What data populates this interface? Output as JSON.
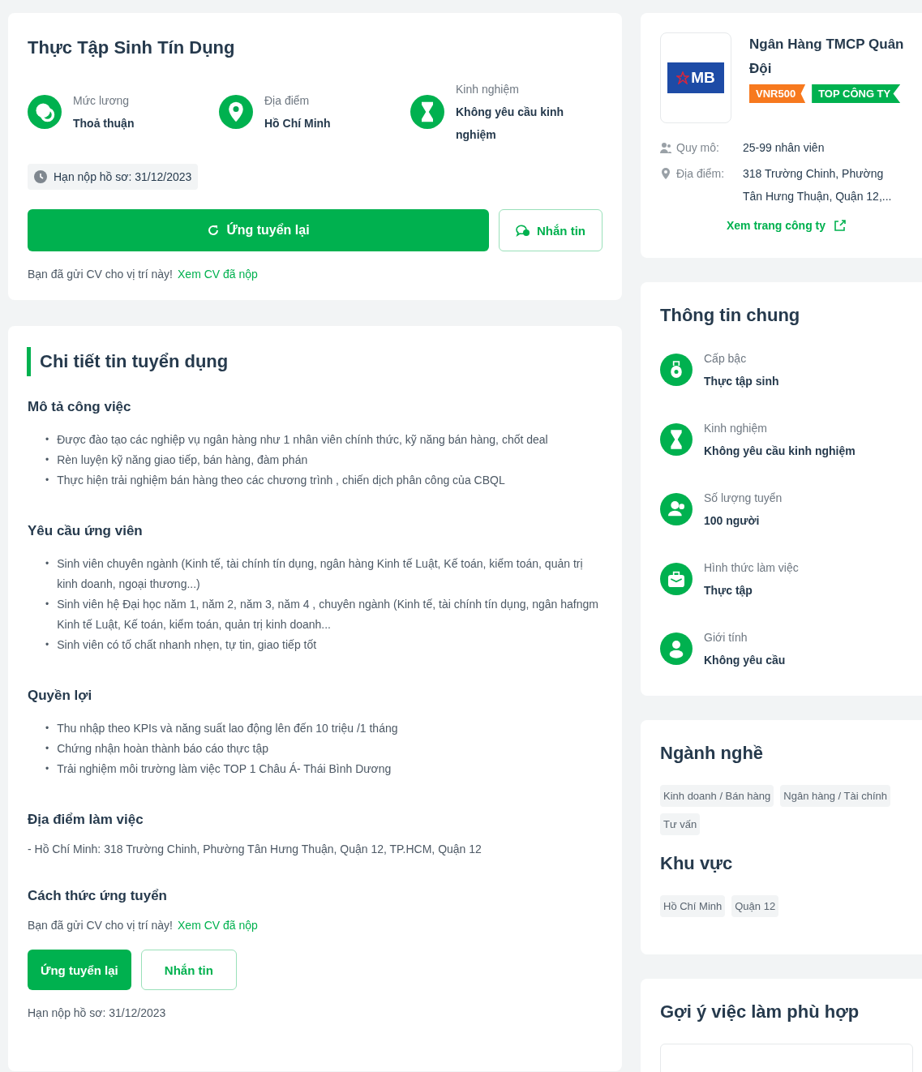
{
  "job": {
    "title": "Thực Tập Sinh Tín Dụng",
    "highlights": [
      {
        "kind": "salary",
        "label": "Mức lương",
        "value": "Thoả thuận"
      },
      {
        "kind": "location",
        "label": "Địa điểm",
        "value": "Hồ Chí Minh"
      },
      {
        "kind": "experience",
        "label": "Kinh nghiệm",
        "value": "Không yêu cầu kinh nghiệm"
      }
    ],
    "deadline": "Hạn nộp hồ sơ: 31/12/2023",
    "apply_button": "Ứng tuyển lại",
    "message_button": "Nhắn tin",
    "applied_note": "Bạn đã gửi CV cho vị trí này!",
    "applied_link": "Xem CV đã nộp"
  },
  "details": {
    "heading": "Chi tiết tin tuyển dụng",
    "sections": [
      {
        "kind": "list",
        "title": "Mô tả công việc",
        "bullet": "•",
        "items": [
          "Được đào tạo các nghiệp vụ ngân hàng như 1 nhân viên chính thức, kỹ năng bán hàng, chốt deal",
          "Rèn luyện kỹ năng giao tiếp, bán hàng, đàm phán",
          "Thực hiện trải nghiệm bán hàng theo các chương trình , chiến dịch phân  công của CBQL"
        ]
      },
      {
        "kind": "list",
        "title": "Yêu cầu ứng viên",
        "bullet": "•",
        "items": [
          "Sinh viên chuyên ngành (Kinh tế, tài chính tín dụng, ngân hàng Kinh tế Luật, Kế toán, kiểm toán, quản trị kinh doanh, ngoại thương...)",
          "Sinh viên hệ Đại học  năm 1, năm 2, năm 3, năm 4 , chuyên ngành (Kinh tế, tài chính tín dụng, ngân hafngm Kinh tế Luật, Kế toán, kiểm toán, quản trị kinh doanh...",
          "Sinh viên có tố chất nhanh nhẹn, tự tin, giao tiếp tốt"
        ]
      },
      {
        "kind": "list",
        "title": "Quyền lợi",
        "bullet": "•",
        "items": [
          "Thu nhập theo KPIs và năng suất lao động lên đến 10 triệu /1 tháng",
          "Chứng nhận hoàn thành báo cáo thực tập",
          "Trải nghiệm môi trường làm việc TOP 1 Châu Á- Thái Bình Dương"
        ]
      },
      {
        "kind": "text",
        "title": "Địa điểm làm việc",
        "text": "- Hồ Chí Minh: 318 Trường Chinh, Phường Tân Hưng Thuận, Quận 12, TP.HCM, Quận 12"
      },
      {
        "kind": "apply",
        "title": "Cách thức ứng tuyển",
        "note": "Bạn đã gửi CV cho vị trí này!",
        "link": "Xem CV đã nộp",
        "apply_button": "Ứng tuyển lại",
        "message_button": "Nhắn tin",
        "deadline": "Hạn nộp hồ sơ: 31/12/2023"
      }
    ]
  },
  "company": {
    "logo_text": "MB",
    "name": "Ngân Hàng TMCP Quân Đội",
    "badges": [
      {
        "text": "VNR500",
        "color": "#f7791e"
      },
      {
        "text": "TOP CÔNG TY",
        "color": "#00b14f"
      }
    ],
    "facts": [
      {
        "kind": "scale",
        "label": "Quy mô:",
        "value": "25-99 nhân viên"
      },
      {
        "kind": "address",
        "label": "Địa điểm:",
        "value": "318 Trường Chinh, Phường Tân Hưng Thuận, Quận 12,..."
      }
    ],
    "link": "Xem trang công ty"
  },
  "general": {
    "title": "Thông tin chung",
    "items": [
      {
        "kind": "rank",
        "label": "Cấp bậc",
        "value": "Thực tập sinh"
      },
      {
        "kind": "experience",
        "label": "Kinh nghiệm",
        "value": "Không yêu cầu kinh nghiệm"
      },
      {
        "kind": "people",
        "label": "Số lượng tuyển",
        "value": "100 người"
      },
      {
        "kind": "work",
        "label": "Hình thức làm việc",
        "value": "Thực tập"
      },
      {
        "kind": "gender",
        "label": "Giới tính",
        "value": "Không yêu cầu"
      }
    ]
  },
  "categories": {
    "title": "Ngành nghề",
    "tags": [
      "Kinh doanh / Bán hàng",
      "Ngân hàng / Tài chính",
      "Tư vấn"
    ]
  },
  "region": {
    "title": "Khu vực",
    "tags": [
      "Hồ Chí Minh",
      "Quận 12"
    ]
  },
  "suggestions": {
    "title": "Gợi ý việc làm phù hợp"
  }
}
